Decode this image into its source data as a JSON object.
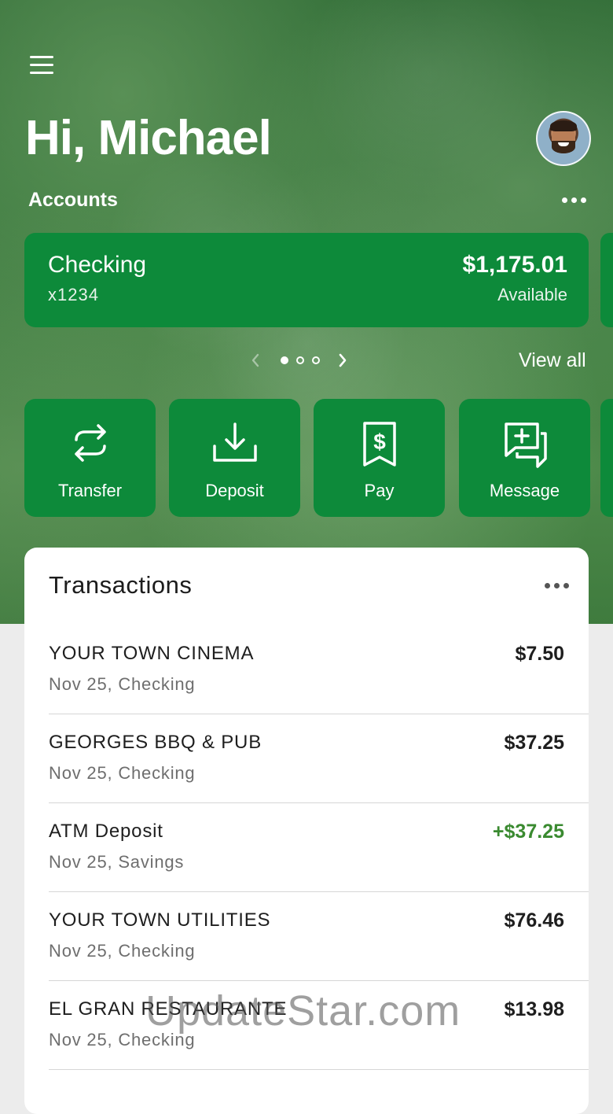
{
  "header": {
    "greeting": "Hi, Michael"
  },
  "accounts": {
    "label": "Accounts",
    "card": {
      "name": "Checking",
      "number": "x1234",
      "balance": "$1,175.01",
      "balance_label": "Available"
    },
    "pager": {
      "total": 3,
      "active": 1
    },
    "view_all": "View all"
  },
  "quick_actions": [
    {
      "label": "Transfer",
      "icon": "transfer-icon"
    },
    {
      "label": "Deposit",
      "icon": "deposit-icon"
    },
    {
      "label": "Pay",
      "icon": "pay-bill-icon"
    },
    {
      "label": "Message",
      "icon": "message-icon"
    }
  ],
  "transactions": {
    "title": "Transactions",
    "items": [
      {
        "merchant": "YOUR TOWN CINEMA",
        "detail": "Nov 25, Checking",
        "amount": "$7.50",
        "credit": false
      },
      {
        "merchant": "GEORGES BBQ & PUB",
        "detail": "Nov 25, Checking",
        "amount": "$37.25",
        "credit": false
      },
      {
        "merchant": "ATM Deposit",
        "detail": "Nov 25, Savings",
        "amount": "+$37.25",
        "credit": true
      },
      {
        "merchant": "YOUR TOWN UTILITIES",
        "detail": "Nov 25, Checking",
        "amount": "$76.46",
        "credit": false
      },
      {
        "merchant": "EL GRAN RESTAURANTE",
        "detail": "Nov 25, Checking",
        "amount": "$13.98",
        "credit": false
      }
    ]
  },
  "watermark": "UpdateStar.com",
  "colors": {
    "brand_green": "#0d8a3a",
    "credit_green": "#3a8a30"
  }
}
